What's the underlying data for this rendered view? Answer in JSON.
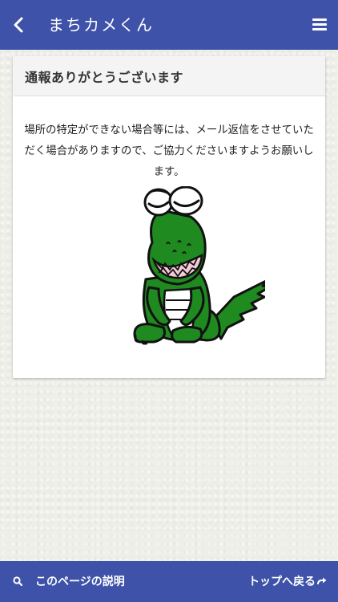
{
  "header": {
    "title": "まちカメくん",
    "back_icon": "chevron-left-icon",
    "menu_icon": "hamburger-menu-icon"
  },
  "card": {
    "title": "通報ありがとうございます",
    "message": "場所の特定ができない場合等には、メール返信をさせていただく場合がありますので、ご協力くださいますようお願いします。"
  },
  "footer": {
    "help_label": "このページの説明",
    "help_icon": "search-icon",
    "top_label": "トップへ戻る",
    "top_icon": "arrow-return-icon"
  },
  "colors": {
    "header_bg": "#3d52a8",
    "footer_bg": "#3d52a8",
    "mascot_green": "#1f8a1f"
  }
}
